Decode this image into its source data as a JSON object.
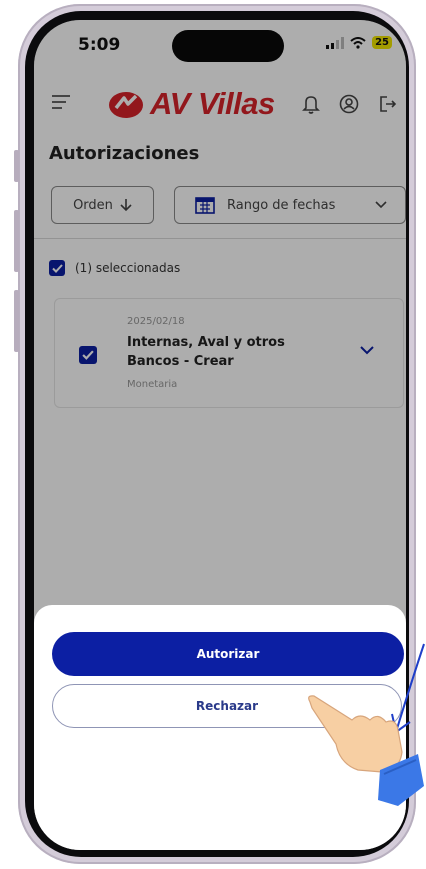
{
  "status_bar": {
    "time": "5:09",
    "battery": "25"
  },
  "header": {
    "logo_text": "AV Villas"
  },
  "page": {
    "title": "Autorizaciones"
  },
  "filters": {
    "order_label": "Orden",
    "date_range_label": "Rango de fechas"
  },
  "selection": {
    "summary": "(1) seleccionadas"
  },
  "items": [
    {
      "date": "2025/02/18",
      "name": "Internas, Aval y otros Bancos - Crear",
      "type": "Monetaria",
      "checked": true
    }
  ],
  "sheet": {
    "authorize_label": "Autorizar",
    "reject_label": "Rechazar"
  },
  "colors": {
    "brand_red": "#d8232a",
    "primary_blue": "#0c1fa3",
    "battery_yellow": "#f1e600"
  }
}
